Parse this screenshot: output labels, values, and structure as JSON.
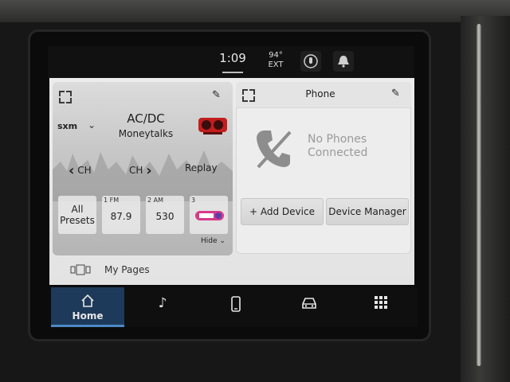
{
  "status_bar": {
    "time": "1:09",
    "temperature": "94°",
    "temperature_label": "EXT",
    "icons": [
      "voice-mic-icon",
      "notification-bell-icon"
    ]
  },
  "radio": {
    "source_logo": "sxm",
    "artist": "AC/DC",
    "song": "Moneytalks",
    "channel_logo": "ozzy-boneyard-logo",
    "ch_prev_label": "CH",
    "ch_next_label": "CH",
    "replay_label": "Replay",
    "presets": [
      {
        "number": "",
        "label": "All Presets"
      },
      {
        "number": "1 FM",
        "label": "87.9"
      },
      {
        "number": "2 AM",
        "label": "530"
      },
      {
        "number": "3",
        "label": ""
      }
    ],
    "preset_3_logo": "hits1-logo",
    "hide_label": "Hide"
  },
  "phone": {
    "title": "Phone",
    "status_line1": "No Phones",
    "status_line2": "Connected",
    "add_device_label": "+ Add Device",
    "device_manager_label": "Device Manager"
  },
  "my_pages": {
    "label": "My Pages"
  },
  "nav": {
    "home_label": "Home",
    "items": [
      "home-icon",
      "music-note-icon",
      "phone-icon",
      "car-icon",
      "apps-grid-icon"
    ]
  },
  "colors": {
    "home_active_bg": "#1e3a5a",
    "home_active_accent": "#4d89c6",
    "screen_bg": "#ececec",
    "navbar_bg": "#0f0f10"
  }
}
